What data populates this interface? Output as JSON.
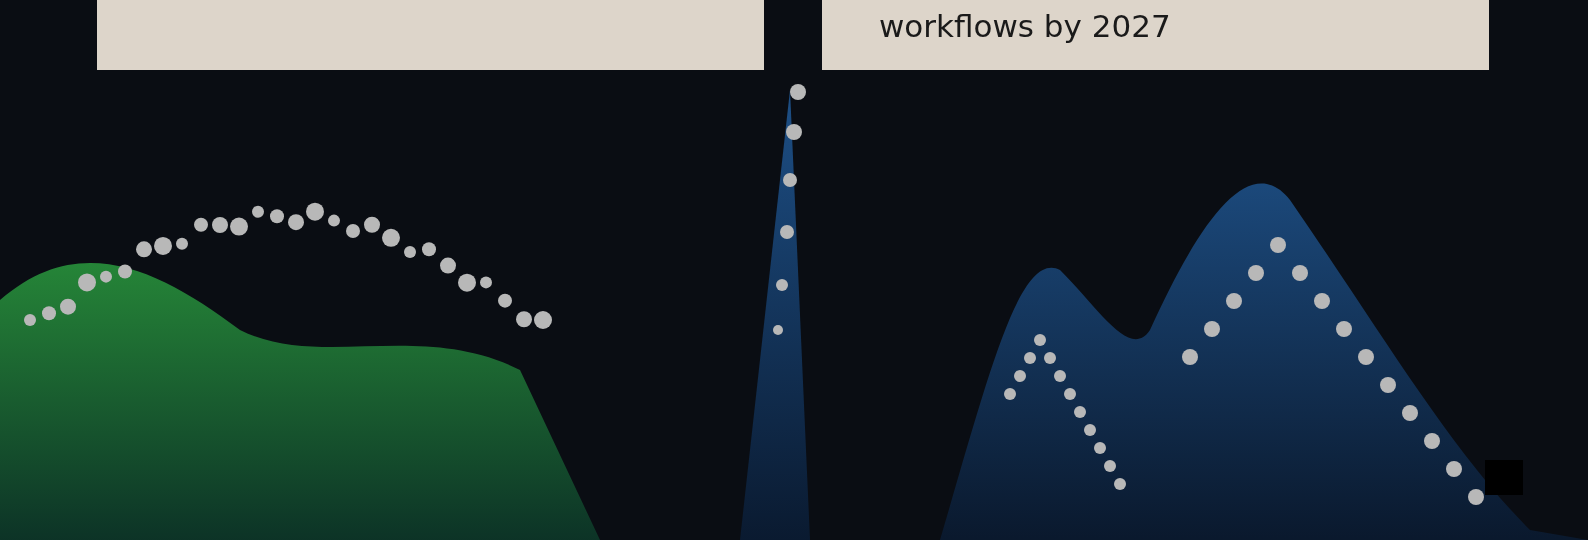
{
  "cards": [
    {
      "kind": "blank"
    },
    {
      "kind": "text",
      "text": "workflows by 2027"
    }
  ]
}
